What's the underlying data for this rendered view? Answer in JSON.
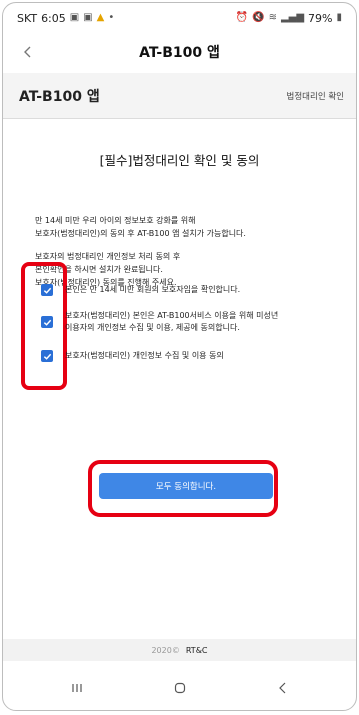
{
  "status_bar": {
    "carrier": "SKT",
    "time": "6:05",
    "battery": "79%",
    "icons_left": [
      "gallery-icon",
      "gallery-icon",
      "warning-icon",
      "dot-icon"
    ],
    "icons_right": [
      "alarm-icon",
      "mute-icon",
      "wifi-icon",
      "signal-icon",
      "battery-icon"
    ]
  },
  "app_bar": {
    "title": "AT-B100 앱",
    "back_icon": "chevron-left-icon"
  },
  "page_header": {
    "title": "AT-B100 앱",
    "breadcrumb": "법정대리인 확인"
  },
  "consent": {
    "heading": "[필수]법정대리인 확인 및 동의",
    "intro_lines": [
      "만 14세 미만 우리 아이의 정보보호 강화를 위해",
      "보호자(법정대리인)의 동의 후 AT-B100 앱 설치가 가능합니다."
    ],
    "guide_lines": [
      "보호자의 법정대리인 개인정보 처리 동의 후",
      "본인확인을 하시면 설치가 완료됩니다.",
      "보호자(법정대리인) 동의를 진행해 주세요."
    ],
    "checkboxes": [
      {
        "lines": [
          "본인은 만 14세 미만 회원의 보호자임을 확인합니다."
        ],
        "checked": true
      },
      {
        "lines": [
          "보호자(법정대리인) 본인은 AT-B100서비스 이용을 위해 미성년",
          "이용자의 개인정보 수집 및 이용, 제공에 동의합니다."
        ],
        "checked": true
      },
      {
        "lines": [
          "보호자(법정대리인) 개인정보 수집 및 이용 동의"
        ],
        "checked": true
      }
    ],
    "agree_all_label": "모두 동의합니다."
  },
  "footer": {
    "year": "2020©",
    "brand": "RT&C"
  },
  "colors": {
    "accent": "#3f87e6",
    "checkbox": "#2a6fd6",
    "highlight": "#e60012"
  },
  "nav_bar": {
    "icons": [
      "recents-icon",
      "home-icon",
      "back-icon"
    ]
  }
}
